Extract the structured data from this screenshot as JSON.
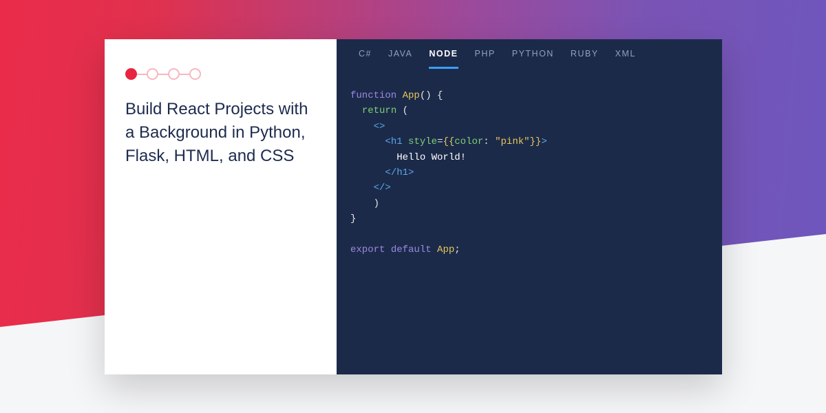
{
  "title": "Build React Projects with a Background in Python, Flask, HTML, and CSS",
  "progress": {
    "total": 4,
    "current": 1
  },
  "tabs": [
    {
      "label": "C#"
    },
    {
      "label": "JAVA"
    },
    {
      "label": "NODE",
      "active": true
    },
    {
      "label": "PHP"
    },
    {
      "label": "PYTHON"
    },
    {
      "label": "RUBY"
    },
    {
      "label": "XML"
    }
  ],
  "code": {
    "l1_kw": "function",
    "l1_fn": "App",
    "l1_rest": "() {",
    "l2_ret": "return",
    "l2_paren": " (",
    "l3": "<>",
    "l4_open": "<",
    "l4_tag": "h1",
    "l4_sp": " ",
    "l4_attr": "style",
    "l4_eq": "=",
    "l4_b1": "{{",
    "l4_key": "color",
    "l4_colon": ": ",
    "l4_str": "\"pink\"",
    "l4_b2": "}}",
    "l4_close": ">",
    "l5": "Hello World!",
    "l6_open": "</",
    "l6_tag": "h1",
    "l6_close": ">",
    "l7": "</>",
    "l8": ")",
    "l9": "}",
    "l11_kw": "export",
    "l11_def": "default",
    "l11_fn": "App",
    "l11_semi": ";"
  }
}
